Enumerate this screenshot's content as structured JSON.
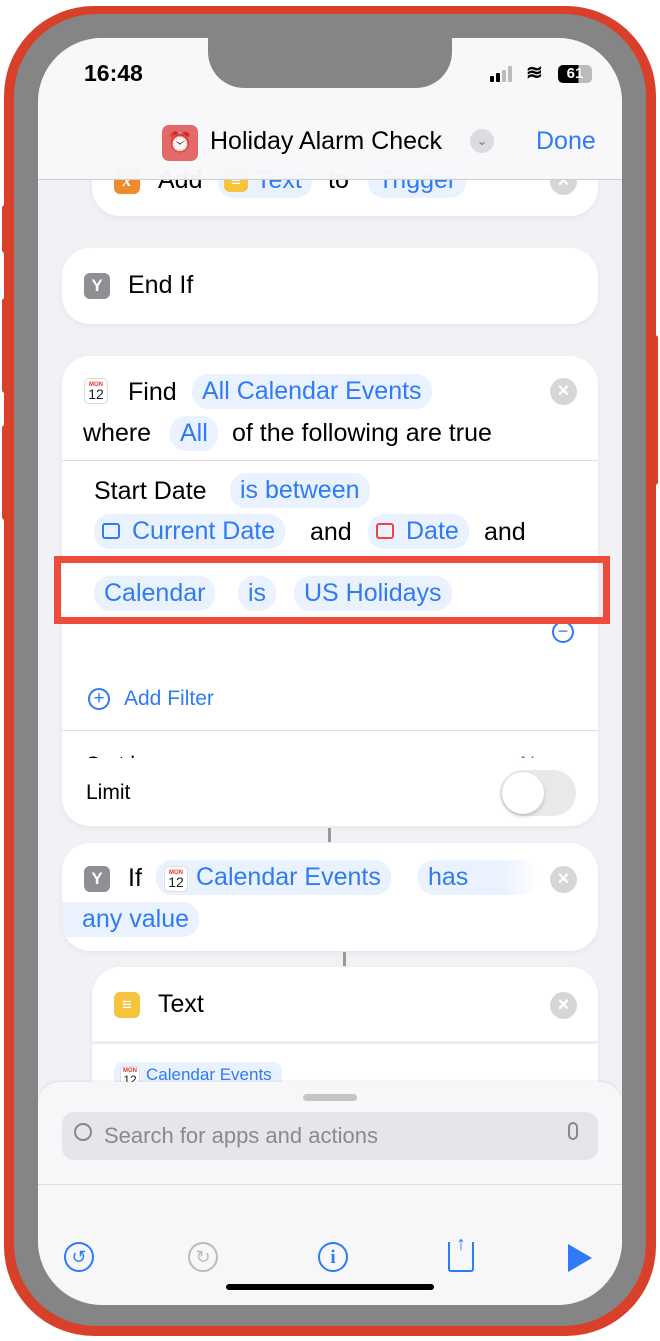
{
  "status": {
    "time": "16:48",
    "battery": "61"
  },
  "header": {
    "title": "Holiday Alarm Check",
    "done": "Done"
  },
  "add_action": {
    "verb": "Add",
    "var": "Text",
    "to": "to",
    "target": "Trigger"
  },
  "end_if": {
    "label": "End If"
  },
  "find": {
    "verb": "Find",
    "source": "All Calendar Events",
    "where": "where",
    "quantifier": "All",
    "rest": "of the following are true",
    "filter1": {
      "field": "Start Date",
      "op": "is between",
      "from": "Current Date",
      "and1": "and",
      "to": "Date",
      "and2": "and"
    },
    "filter2": {
      "field": "Calendar",
      "op": "is",
      "value": "US Holidays"
    },
    "add_filter": "Add Filter",
    "sort_label": "Sort by",
    "sort_value": "None",
    "limit_label": "Limit",
    "limit_on": false
  },
  "if_action": {
    "verb": "If",
    "var": "Calendar Events",
    "op": "has",
    "op2": "any value"
  },
  "text_action": {
    "label": "Text",
    "var": "Calendar Events"
  },
  "search": {
    "placeholder": "Search for apps and actions"
  },
  "colors": {
    "accent": "#2f7bf5",
    "highlight": "#ee4b3c"
  }
}
